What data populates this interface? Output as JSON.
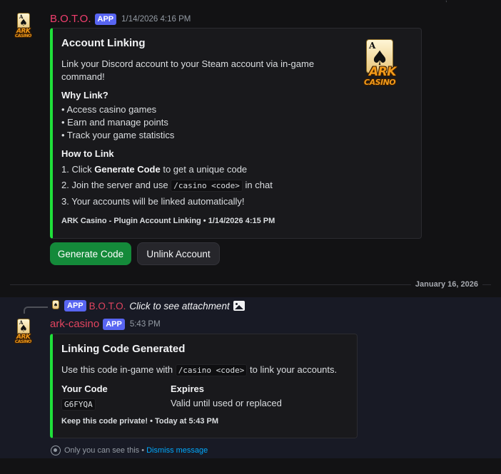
{
  "top_corner": "',",
  "message1": {
    "author": "B.O.T.O.",
    "badge": "APP",
    "timestamp": "1/14/2026 4:16 PM",
    "embed": {
      "title": "Account Linking",
      "description_line1": "Link your Discord account to your Steam account via in-game",
      "description_line2": "command!",
      "why_title": "Why Link?",
      "why_items": [
        "• Access casino games",
        "• Earn and manage points",
        "• Track your game statistics"
      ],
      "how_title": "How to Link",
      "step1_prefix": "1. Click ",
      "step1_bold": "Generate Code",
      "step1_suffix": " to get a unique code",
      "step2_prefix": "2. Join the server and use ",
      "step2_code": "/casino <code>",
      "step2_suffix": " in chat",
      "step3": "3. Your accounts will be linked automatically!",
      "footer": "ARK Casino - Plugin Account Linking • 1/14/2026 4:15 PM",
      "thumbnail": {
        "card_letter": "A",
        "word1": "ARK",
        "word2": "CASINO"
      }
    },
    "buttons": {
      "generate": "Generate Code",
      "unlink": "Unlink Account"
    }
  },
  "date_divider": "January 16, 2026",
  "reply": {
    "badge": "APP",
    "author": "B.O.T.O.",
    "text": "Click to see attachment"
  },
  "message2": {
    "author": "ark-casino",
    "badge": "APP",
    "timestamp": "5:43 PM",
    "embed": {
      "title": "Linking Code Generated",
      "desc_prefix": "Use this code in-game with ",
      "desc_code": "/casino <code>",
      "desc_suffix": " to link your accounts.",
      "field1_name": "Your Code",
      "field1_value": "G6FYQA",
      "field2_name": "Expires",
      "field2_value": "Valid until used or replaced",
      "footer": "Keep this code private! • Today at 5:43 PM"
    }
  },
  "ephemeral": {
    "only_you": "Only you can see this •",
    "dismiss": "Dismiss message"
  },
  "avatar": {
    "card_letter": "A",
    "word1": "ARK",
    "word2": "CASINO"
  },
  "colors": {
    "accent_green": "#1fe03a",
    "app_badge": "#5865f2",
    "author_pink": "#f23f6f",
    "link_blue": "#00a8fc"
  }
}
